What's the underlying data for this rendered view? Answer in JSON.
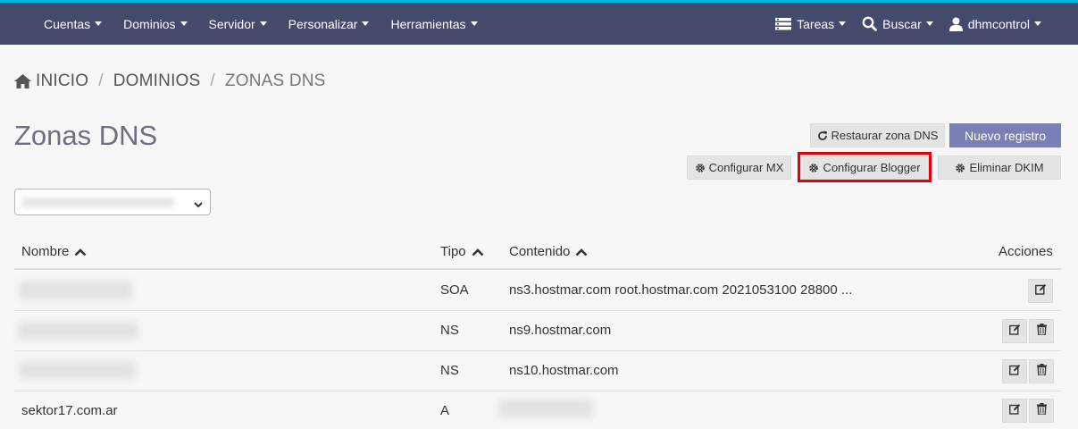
{
  "nav": {
    "left_items": [
      "Cuentas",
      "Dominios",
      "Servidor",
      "Personalizar",
      "Herramientas"
    ],
    "tasks_label": "Tareas",
    "search_label": "Buscar",
    "user_label": "dhmcontrol"
  },
  "breadcrumb": {
    "home": "INICIO",
    "domains": "DOMINIOS",
    "current": "ZONAS DNS",
    "separator": "/"
  },
  "page": {
    "title": "Zonas DNS"
  },
  "actions": {
    "restore_label": "Restaurar zona DNS",
    "new_record_label": "Nuevo registro",
    "config_mx_label": "Configurar MX",
    "config_blogger_label": "Configurar Blogger",
    "delete_dkim_label": "Eliminar DKIM"
  },
  "table": {
    "headers": {
      "name": "Nombre",
      "type": "Tipo",
      "content": "Contenido",
      "actions": "Acciones"
    },
    "rows": [
      {
        "name": "",
        "type": "SOA",
        "content": "ns3.hostmar.com root.hostmar.com 2021053100 28800 ..."
      },
      {
        "name": "",
        "type": "NS",
        "content": "ns9.hostmar.com"
      },
      {
        "name": "",
        "type": "NS",
        "content": "ns10.hostmar.com"
      },
      {
        "name": "sektor17.com.ar",
        "type": "A",
        "content": ""
      }
    ]
  },
  "colors": {
    "navbar": "#434a6c",
    "top_accent": "#00b7e3",
    "primary_button": "#7a80b4",
    "highlight_border": "#e3000f"
  }
}
